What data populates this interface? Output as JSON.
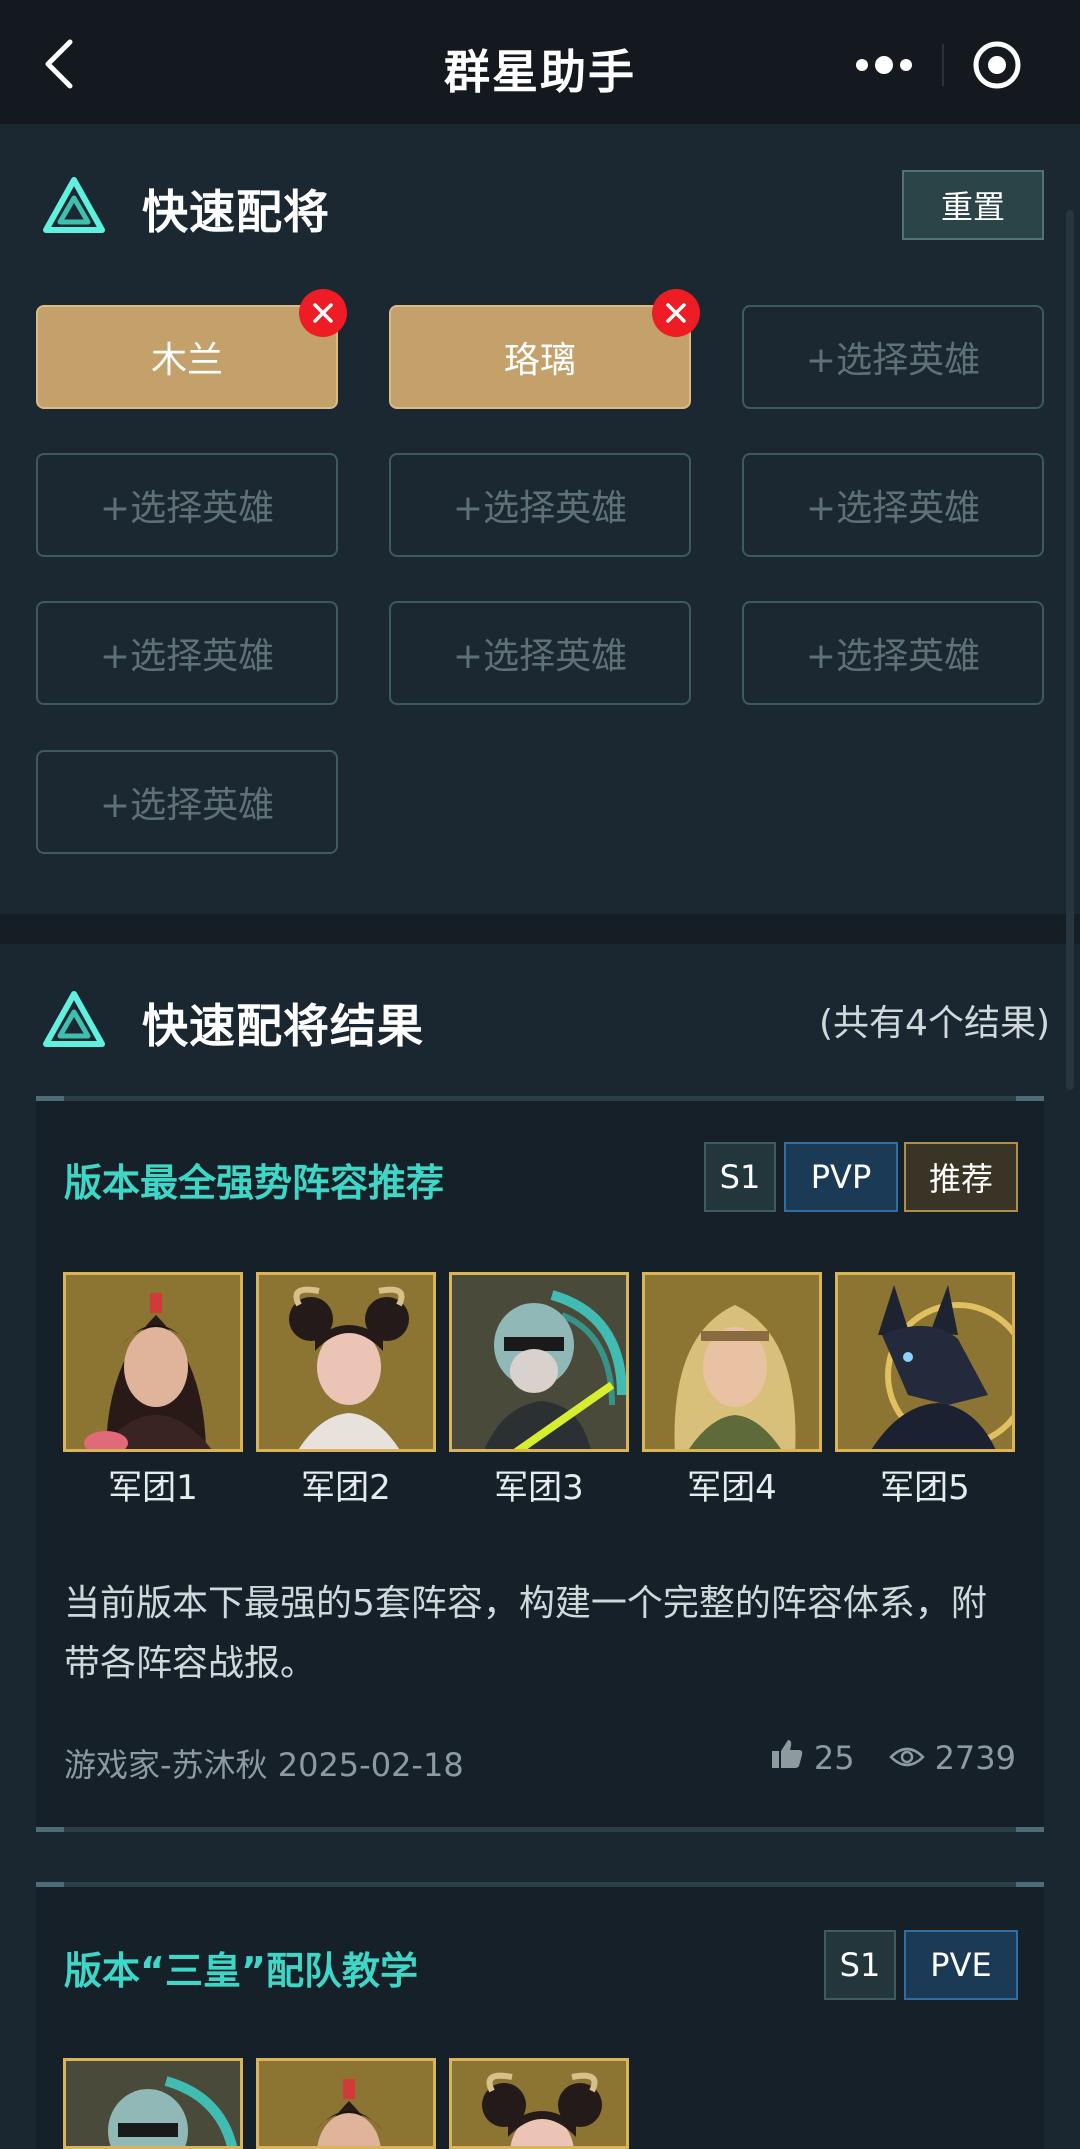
{
  "nav": {
    "title": "群星助手"
  },
  "quick": {
    "title": "快速配将",
    "reset_label": "重置",
    "slots": [
      {
        "label": "木兰",
        "filled": true
      },
      {
        "label": "珞璃",
        "filled": true
      },
      {
        "label": "+选择英雄",
        "filled": false
      },
      {
        "label": "+选择英雄",
        "filled": false
      },
      {
        "label": "+选择英雄",
        "filled": false
      },
      {
        "label": "+选择英雄",
        "filled": false
      },
      {
        "label": "+选择英雄",
        "filled": false
      },
      {
        "label": "+选择英雄",
        "filled": false
      },
      {
        "label": "+选择英雄",
        "filled": false
      },
      {
        "label": "+选择英雄",
        "filled": false
      }
    ]
  },
  "results": {
    "title": "快速配将结果",
    "count_text": "(共有4个结果)",
    "cards": [
      {
        "title": "版本最全强势阵容推荐",
        "tags": [
          "S1",
          "PVP",
          "推荐"
        ],
        "heroes": [
          "军团1",
          "军团2",
          "军团3",
          "军团4",
          "军团5"
        ],
        "description": "当前版本下最强的5套阵容，构建一个完整的阵容体系，附带各阵容战报。",
        "author_date": "游戏家-苏沐秋 2025-02-18",
        "likes": "25",
        "views": "2739"
      },
      {
        "title": "版本“三皇”配队教学",
        "tags": [
          "S1",
          "PVE"
        ]
      }
    ]
  },
  "colors": {
    "accent_teal": "#3ed6c6",
    "filled_slot": "#c4a16a",
    "remove_red": "#ee1c25",
    "tag_pvp_border": "#2e6ea2",
    "tag_rec_border": "#b08d48"
  }
}
